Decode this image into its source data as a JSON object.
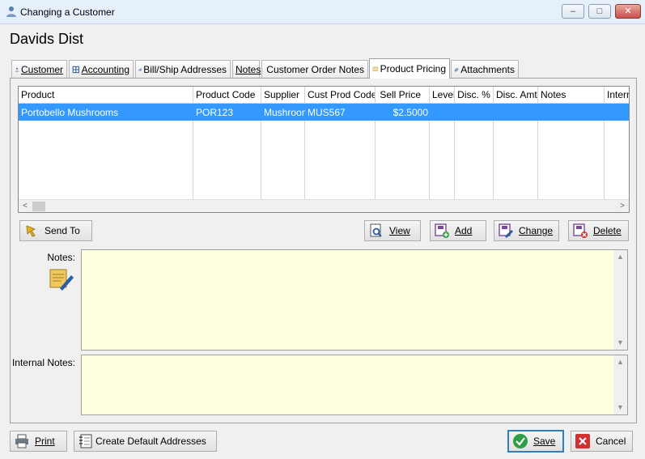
{
  "window": {
    "title": "Changing a Customer",
    "minimize_glyph": "‒",
    "maximize_glyph": "□",
    "close_glyph": "✕"
  },
  "customer_name": "Davids Dist",
  "tabs": [
    {
      "label": "Customer",
      "icon": "customer-icon"
    },
    {
      "label": "Accounting",
      "icon": "accounting-icon"
    },
    {
      "label": "Bill/Ship Addresses",
      "icon": "address-icon"
    },
    {
      "label": "Notes",
      "icon": ""
    },
    {
      "label": "Customer Order Notes",
      "icon": "order-notes-icon"
    },
    {
      "label": "Product Pricing",
      "icon": "product-pricing-icon",
      "active": true
    },
    {
      "label": "Attachments",
      "icon": "paperclip-icon"
    }
  ],
  "grid": {
    "columns": [
      "Product",
      "Product Code",
      "Supplier",
      "Cust Prod Code",
      "Sell Price",
      "Level",
      "Disc. %",
      "Disc. Amt",
      "Notes",
      "Intern"
    ],
    "rows": [
      [
        "Portobello Mushrooms",
        "POR123",
        "Mushroom",
        "MUS567",
        "$2.5000",
        "",
        "",
        "",
        "",
        ""
      ]
    ],
    "scroll_left": "<",
    "scroll_right": ">"
  },
  "buttons": {
    "send_to": "Send To",
    "view": "View",
    "add": "Add",
    "change": "Change",
    "delete": "Delete",
    "print": "Print",
    "create_default_addresses": "Create Default Addresses",
    "save": "Save",
    "cancel": "Cancel"
  },
  "fields": {
    "notes_label": "Notes:",
    "notes_value": "",
    "internal_notes_label": "Internal Notes:",
    "internal_notes_value": ""
  },
  "colors": {
    "selection": "#3399ff",
    "memo_background": "#ffffe1",
    "save_accent": "#2f9e44",
    "cancel_accent": "#d03030"
  }
}
